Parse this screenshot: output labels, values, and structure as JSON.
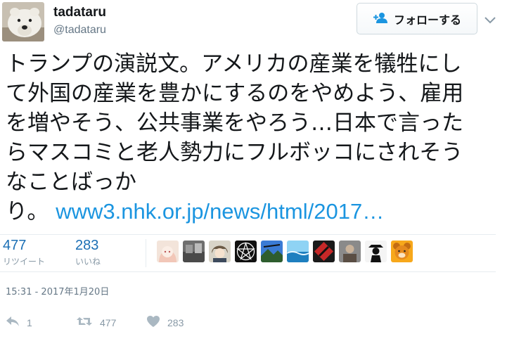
{
  "user": {
    "display_name": "tadataru",
    "screen_name": "@tadataru",
    "avatar_icon": "polar-bear-avatar"
  },
  "follow_button": {
    "label": "フォローする",
    "icon": "add-user-icon"
  },
  "tweet": {
    "lines": [
      "トランプの演説文。アメリカの産業を犠牲にし",
      "て外国の産業を豊かにするのをやめよう、雇用",
      "を増やそう、公共事業をやろう…日本で言った",
      "らマスコミと老人勢力にフルボッコにされそう",
      "なことばっか",
      "り。"
    ],
    "link_text": "www3.nhk.or.jp/news/html/2017…",
    "link_color": "#1b95e0"
  },
  "stats": {
    "retweets": {
      "count": "477",
      "label": "リツイート"
    },
    "likes": {
      "count": "283",
      "label": "いいね"
    }
  },
  "liker_avatars": [
    "avatar-anime-girl",
    "avatar-photo-1",
    "avatar-anime-boy",
    "avatar-pentagram",
    "avatar-landscape",
    "avatar-blue-sea",
    "avatar-red-emblem",
    "avatar-photo-2",
    "avatar-silhouette",
    "avatar-bear"
  ],
  "timestamp": "15:31 - 2017年1月20日",
  "actions": {
    "reply": {
      "count": "1",
      "icon": "reply-icon"
    },
    "retweet": {
      "count": "477",
      "icon": "retweet-icon"
    },
    "like": {
      "count": "283",
      "icon": "heart-icon"
    }
  }
}
